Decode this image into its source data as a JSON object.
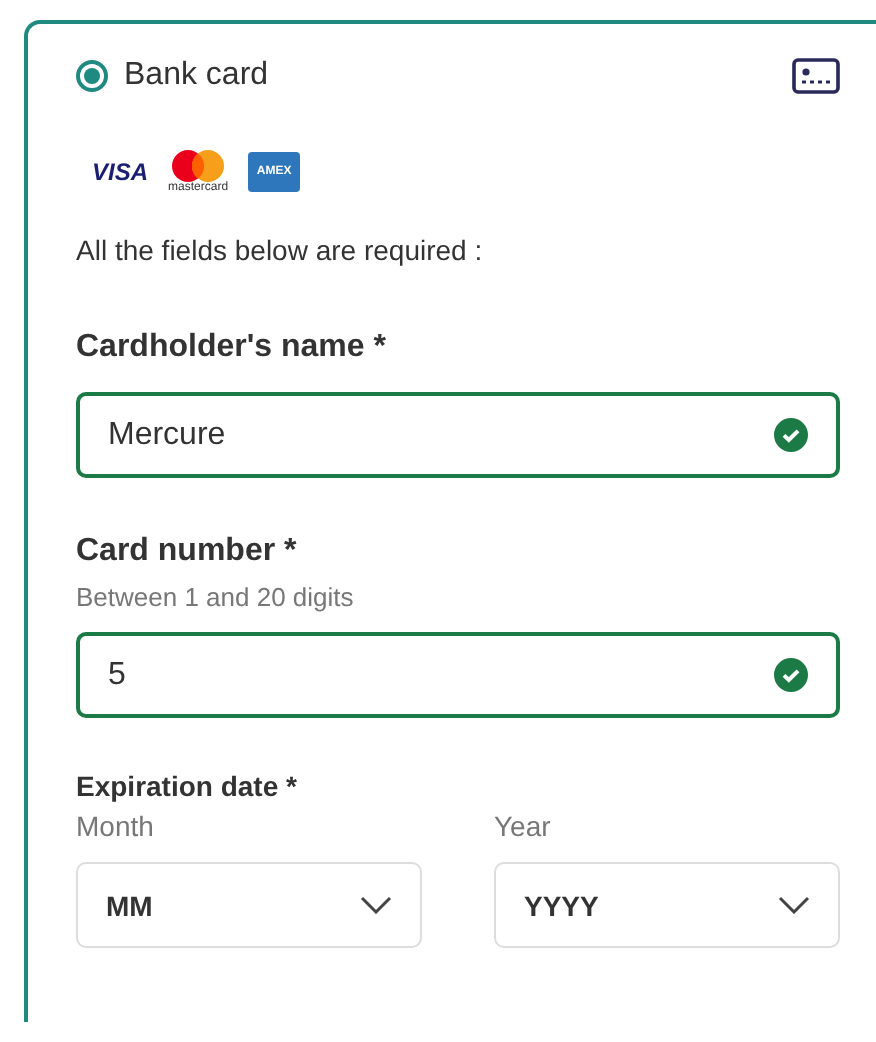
{
  "payment_option": {
    "label": "Bank card",
    "selected": true
  },
  "card_brands": [
    {
      "kind": "visa",
      "label": "VISA"
    },
    {
      "kind": "mastercard",
      "label": "mastercard"
    },
    {
      "kind": "amex",
      "label": "AMEX"
    }
  ],
  "required_note": "All the fields below are required :",
  "fields": [
    {
      "label": "Cardholder's name *",
      "value": "Mercure",
      "valid": true
    },
    {
      "label": "Card number *",
      "hint": "Between 1 and 20 digits",
      "value": "5",
      "valid": true
    }
  ],
  "expiration": {
    "label": "Expiration date *",
    "selects": [
      {
        "label": "Month",
        "value": "MM"
      },
      {
        "label": "Year",
        "value": "YYYY"
      }
    ]
  }
}
